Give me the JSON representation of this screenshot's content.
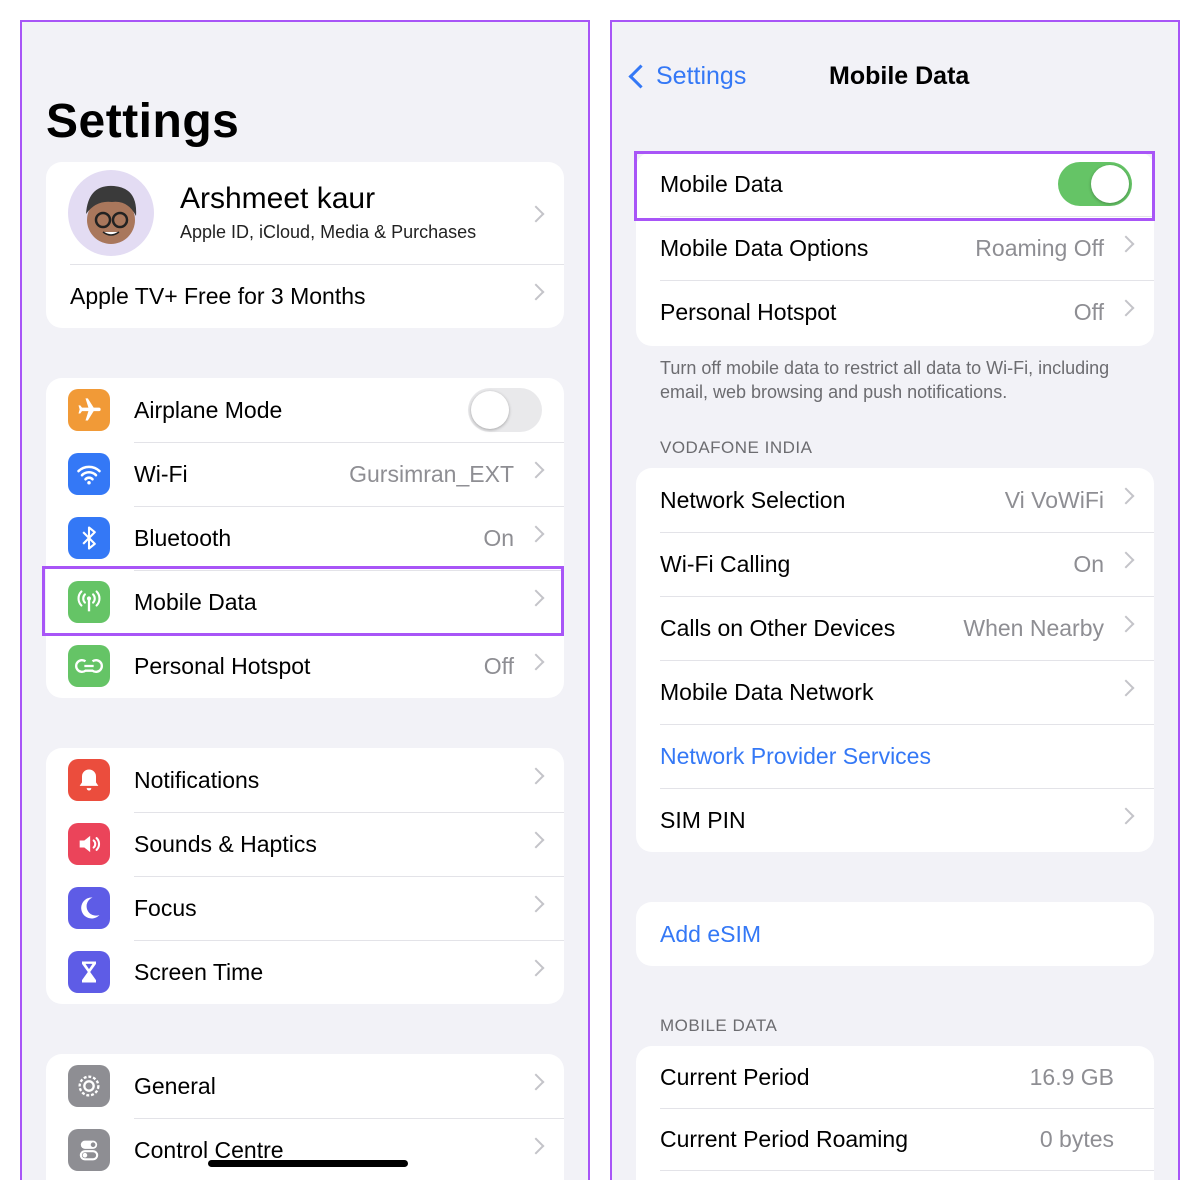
{
  "left": {
    "title": "Settings",
    "profile": {
      "name": "Arshmeet kaur",
      "subtitle": "Apple ID, iCloud, Media & Purchases",
      "promo": "Apple TV+ Free for 3 Months"
    },
    "group1": [
      {
        "label": "Airplane Mode",
        "icon": "airplane-icon",
        "color": "#f19a37",
        "toggle": false
      },
      {
        "label": "Wi-Fi",
        "value": "Gursimran_EXT",
        "icon": "wifi-icon",
        "color": "#3478f6"
      },
      {
        "label": "Bluetooth",
        "value": "On",
        "icon": "bluetooth-icon",
        "color": "#3478f6"
      },
      {
        "label": "Mobile Data",
        "icon": "antenna-icon",
        "color": "#65c466"
      },
      {
        "label": "Personal Hotspot",
        "value": "Off",
        "icon": "hotspot-icon",
        "color": "#65c466"
      }
    ],
    "group2": [
      {
        "label": "Notifications",
        "icon": "bell-icon",
        "color": "#eb4d3d"
      },
      {
        "label": "Sounds & Haptics",
        "icon": "speaker-icon",
        "color": "#eb445a"
      },
      {
        "label": "Focus",
        "icon": "moon-icon",
        "color": "#5e5ce6"
      },
      {
        "label": "Screen Time",
        "icon": "hourglass-icon",
        "color": "#5e5ce6"
      }
    ],
    "group3": [
      {
        "label": "General",
        "icon": "gear-icon",
        "color": "#8e8e93"
      },
      {
        "label": "Control Centre",
        "icon": "switches-icon",
        "color": "#8e8e93"
      }
    ]
  },
  "right": {
    "back_label": "Settings",
    "title": "Mobile Data",
    "group1": [
      {
        "label": "Mobile Data",
        "toggle": true
      },
      {
        "label": "Mobile Data Options",
        "value": "Roaming Off"
      },
      {
        "label": "Personal Hotspot",
        "value": "Off"
      }
    ],
    "footnote": "Turn off mobile data to restrict all data to Wi-Fi, including email, web browsing and push notifications.",
    "carrier_header": "VODAFONE INDIA",
    "carrier_rows": [
      {
        "label": "Network Selection",
        "value": "Vi VoWiFi"
      },
      {
        "label": "Wi-Fi Calling",
        "value": "On"
      },
      {
        "label": "Calls on Other Devices",
        "value": "When Nearby"
      },
      {
        "label": "Mobile Data Network",
        "value": ""
      },
      {
        "label": "Network Provider Services",
        "value": ""
      },
      {
        "label": "SIM PIN",
        "value": ""
      }
    ],
    "add_esim": "Add eSIM",
    "usage_header": "MOBILE DATA",
    "usage_rows": [
      {
        "label": "Current Period",
        "value": "16.9 GB"
      },
      {
        "label": "Current Period Roaming",
        "value": "0 bytes"
      }
    ]
  },
  "colors": {
    "highlight": "#a855f7",
    "accent": "#3478f6",
    "toggle_on": "#65c466",
    "toggle_off": "#e9e9eb"
  }
}
